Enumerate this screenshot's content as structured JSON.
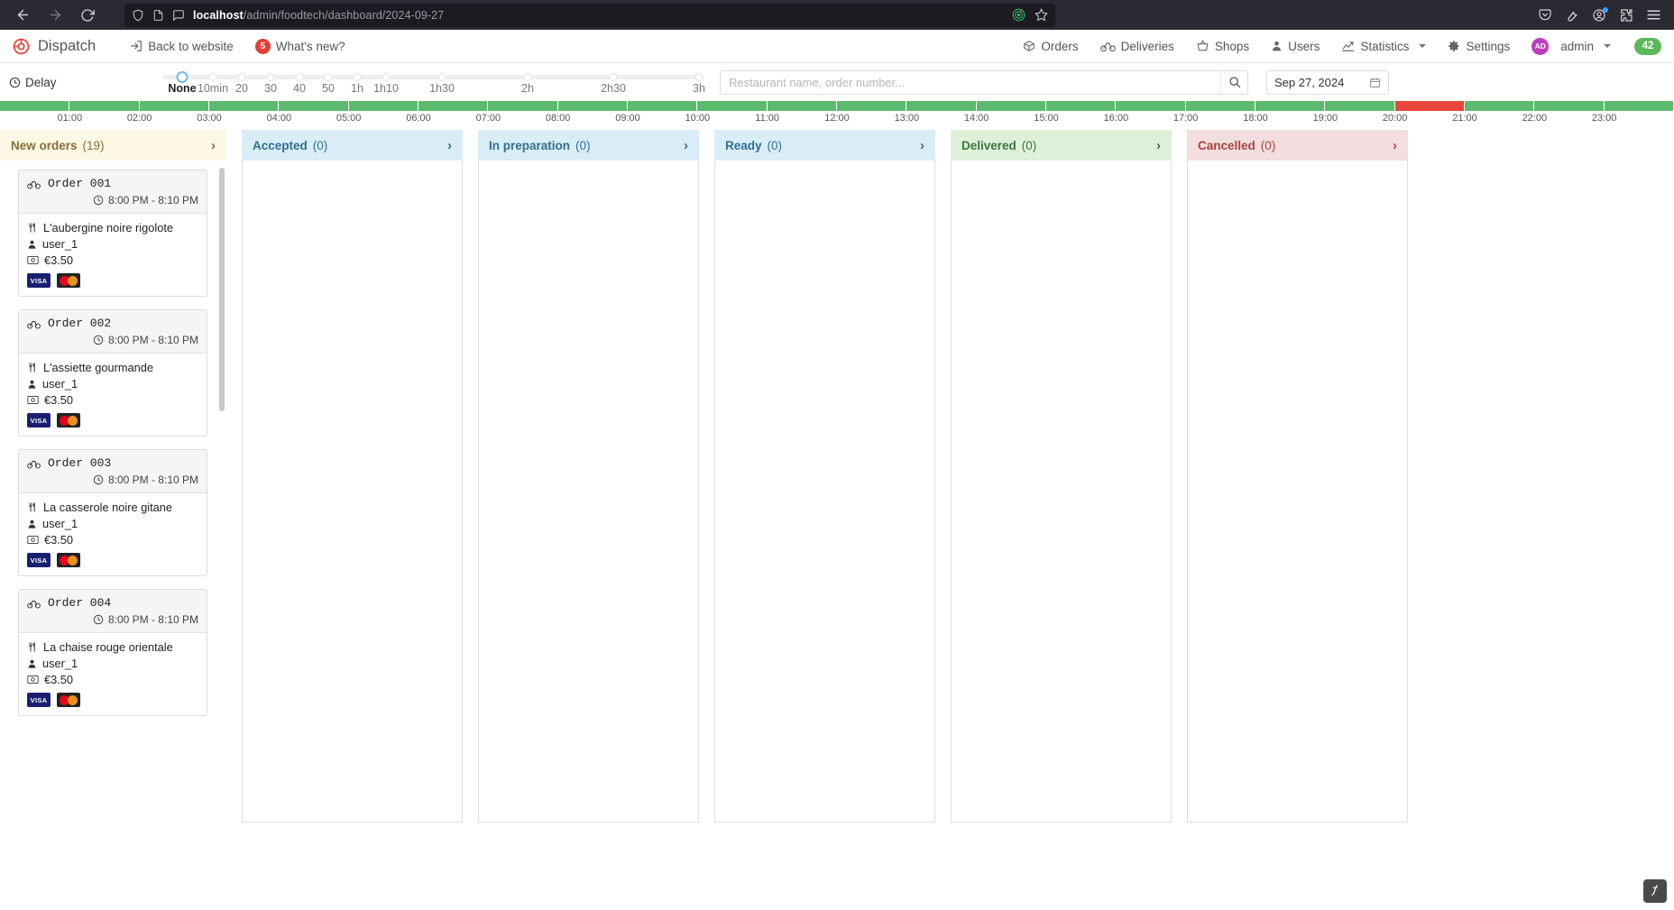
{
  "browser": {
    "url_host": "localhost",
    "url_path": "/admin/foodtech/dashboard/2024-09-27",
    "back_icon": "back-arrow-icon",
    "forward_icon": "forward-arrow-icon",
    "reload_icon": "reload-icon",
    "shield_icon": "shield-icon",
    "page_icon": "page-icon",
    "reader_icon": "reader-view-icon",
    "tracker_icon": "tracking-protection-icon",
    "bookmark_icon": "bookmark-star-icon",
    "pocket_icon": "save-to-pocket-icon",
    "tools_icon": "wrench-icon",
    "account_icon": "account-icon",
    "extensions_icon": "extensions-icon",
    "menu_icon": "hamburger-menu-icon"
  },
  "header": {
    "brand": "Dispatch",
    "brand_icon": "dispatch-logo-icon",
    "back_to_website": "Back to website",
    "back_to_website_icon": "external-link-icon",
    "whats_new": "What's new?",
    "whats_new_count": "5",
    "nav": [
      {
        "label": "Orders",
        "icon": "box-icon"
      },
      {
        "label": "Deliveries",
        "icon": "bicycle-icon"
      },
      {
        "label": "Shops",
        "icon": "basket-icon"
      },
      {
        "label": "Users",
        "icon": "user-icon"
      },
      {
        "label": "Statistics",
        "icon": "chart-line-icon",
        "has_caret": true
      },
      {
        "label": "Settings",
        "icon": "gear-icon"
      }
    ],
    "user": {
      "initials": "AD",
      "name": "admin"
    },
    "counter_badge": "42"
  },
  "controls": {
    "delay_label": "Delay",
    "delay_icon": "clock-icon",
    "slider_ticks": [
      "None",
      "10min",
      "20",
      "30",
      "40",
      "50",
      "1h",
      "1h10",
      "1h30",
      "2h",
      "2h30",
      "3h"
    ],
    "slider_selected": "None",
    "search": {
      "value": "",
      "placeholder": "Restaurant name, order number...",
      "icon": "search-icon"
    },
    "date": {
      "value": "Sep 27, 2024",
      "icon": "calendar-icon"
    }
  },
  "timeline": {
    "labels": [
      "01:00",
      "02:00",
      "03:00",
      "04:00",
      "05:00",
      "06:00",
      "07:00",
      "08:00",
      "09:00",
      "10:00",
      "11:00",
      "12:00",
      "13:00",
      "14:00",
      "15:00",
      "16:00",
      "17:00",
      "18:00",
      "19:00",
      "20:00",
      "21:00",
      "22:00",
      "23:00"
    ],
    "colors": {
      "ok": "#5cba6e",
      "alert": "#e8453c"
    },
    "alert_start_label": "20:00",
    "alert_end_label": "21:00"
  },
  "columns": [
    {
      "id": "new",
      "title": "New orders",
      "count": "(19)",
      "chevron": "chevron-right-icon"
    },
    {
      "id": "accepted",
      "title": "Accepted",
      "count": "(0)",
      "chevron": "chevron-right-icon"
    },
    {
      "id": "prep",
      "title": "In preparation",
      "count": "(0)",
      "chevron": "chevron-right-icon"
    },
    {
      "id": "ready",
      "title": "Ready",
      "count": "(0)",
      "chevron": "chevron-right-icon"
    },
    {
      "id": "delivered",
      "title": "Delivered",
      "count": "(0)",
      "chevron": "chevron-right-icon"
    },
    {
      "id": "cancelled",
      "title": "Cancelled",
      "count": "(0)",
      "chevron": "chevron-right-icon"
    }
  ],
  "orders": [
    {
      "id": "Order 001",
      "time": "8:00 PM - 8:10 PM",
      "restaurant": "L'aubergine noire rigolote",
      "user": "user_1",
      "price": "€3.50",
      "payments": [
        "VISA",
        "MasterCard"
      ]
    },
    {
      "id": "Order 002",
      "time": "8:00 PM - 8:10 PM",
      "restaurant": "L'assiette gourmande",
      "user": "user_1",
      "price": "€3.50",
      "payments": [
        "VISA",
        "MasterCard"
      ]
    },
    {
      "id": "Order 003",
      "time": "8:00 PM - 8:10 PM",
      "restaurant": "La casserole noire gitane",
      "user": "user_1",
      "price": "€3.50",
      "payments": [
        "VISA",
        "MasterCard"
      ]
    },
    {
      "id": "Order 004",
      "time": "8:00 PM - 8:10 PM",
      "restaurant": "La chaise rouge orientale",
      "user": "user_1",
      "price": "€3.50",
      "payments": [
        "VISA",
        "MasterCard"
      ]
    }
  ],
  "icons": {
    "bike": "bicycle-icon",
    "clock": "clock-icon",
    "cutlery": "cutlery-icon",
    "person": "person-icon",
    "money": "money-icon"
  },
  "corner_logo": "symfony-logo-icon"
}
